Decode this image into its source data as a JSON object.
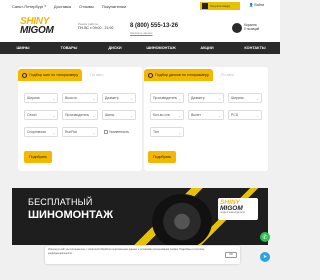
{
  "topbar": {
    "city": "Санкт-Петербург",
    "links": [
      "Доставка",
      "Отзывы",
      "Покупателям"
    ],
    "promo_text": "Получите скидку",
    "login": "Войти"
  },
  "header": {
    "logo_line1": "SHINY",
    "logo_line2": "MIGOM",
    "hours_label": "Режим работы",
    "hours_value": "ПН-ВС с 09:00 - 21:00",
    "phone": "8 (800) 555-13-26",
    "callback": "Заказать звонок",
    "cart_label": "Корзина",
    "cart_value": "0 позиций"
  },
  "nav": [
    "ШИНЫ",
    "ТОВАРЫ",
    "ДИСКИ",
    "ШИНОМОНТАЖ",
    "АКЦИИ",
    "КОНТАКТЫ"
  ],
  "tire_form": {
    "tab_active": "Подбор шин по типоразмеру",
    "tab_inactive": "По авто",
    "fields": [
      "Ширина",
      "Высота",
      "Диаметр",
      "Сезон",
      "Производитель",
      "Шипы",
      "Спортивная",
      "RunFlat"
    ],
    "checkbox": "Усиленность",
    "submit": "Подобрать"
  },
  "disk_form": {
    "tab_active": "Подбор дисков по типоразмеру",
    "tab_inactive": "По авто",
    "fields": [
      "Производитель",
      "Диаметр",
      "Ширина",
      "Кол-во отв.",
      "Вылет",
      "PCD",
      "Тип"
    ],
    "submit": "Подобрать"
  },
  "banner": {
    "line1": "БЕСПЛАТНЫЙ",
    "line2": "ШИНОМОНТАЖ",
    "logo_line1": "SHINY",
    "logo_line2": "MIGOM",
    "logo_sub": "ПОДБОР ШИН И ДИСКОВ"
  },
  "cookie": {
    "text": "Используя сайт, вы соглашаетесь с политикой обработки персональных данных и условиями использования cookies. Подробнее в политике конфиденциальности.",
    "ok": "Ок"
  },
  "colors": {
    "accent": "#f5b800",
    "dark": "#2b2b2b",
    "whatsapp": "#27c04e",
    "telegram": "#2aa3df"
  }
}
